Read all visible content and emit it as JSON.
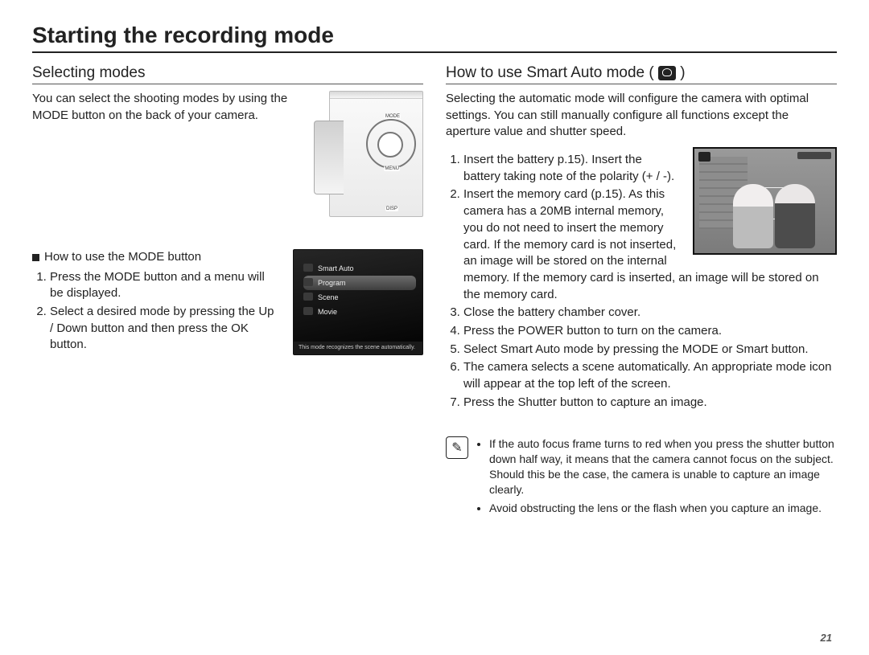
{
  "page_title": "Starting the recording mode",
  "page_number": "21",
  "left": {
    "heading": "Selecting modes",
    "intro": "You can select the shooting modes by using the MODE button on the back of your camera.",
    "camera_labels": {
      "mode": "MODE",
      "menu": "MENU",
      "disp": "DISP"
    },
    "howto_heading": "How to use the MODE button",
    "howto_steps": [
      "Press the MODE button and a menu will be displayed.",
      "Select a desired mode by pressing the Up / Down button and then press the OK button."
    ],
    "menu_items": [
      "Smart Auto",
      "Program",
      "Scene",
      "Movie"
    ],
    "menu_selected_index": 1,
    "menu_hint": "This mode recognizes the scene automatically."
  },
  "right": {
    "heading_prefix": "How to use Smart Auto mode (",
    "heading_suffix": ")",
    "smart_icon_name": "smart-auto-icon",
    "intro": "Selecting the automatic mode will configure the camera with optimal settings. You can still manually configure all functions except the aperture value and shutter speed.",
    "steps": [
      "Insert the battery  p.15). Insert the battery  taking note of the polarity (+ / -).",
      "Insert the memory card (p.15). As this camera has a 20MB internal memory, you do not need to insert the memory card. If the memory card is not inserted, an image will be stored on the internal memory. If the memory card is inserted, an image will be stored on the memory card.",
      "Close the battery chamber cover.",
      "Press the POWER button to turn on the camera.",
      "Select Smart Auto mode by pressing the MODE or Smart button.",
      "The camera selects a scene automatically. An appropriate mode icon will appear at the top left of the screen.",
      "Press the Shutter button to capture an image."
    ],
    "notes": [
      "If the auto focus frame turns to red when you press the shutter button down half way, it means that the camera cannot focus on the subject. Should this be the case, the camera is unable to capture an image clearly.",
      "Avoid obstructing the lens or the flash when you capture an image."
    ]
  }
}
